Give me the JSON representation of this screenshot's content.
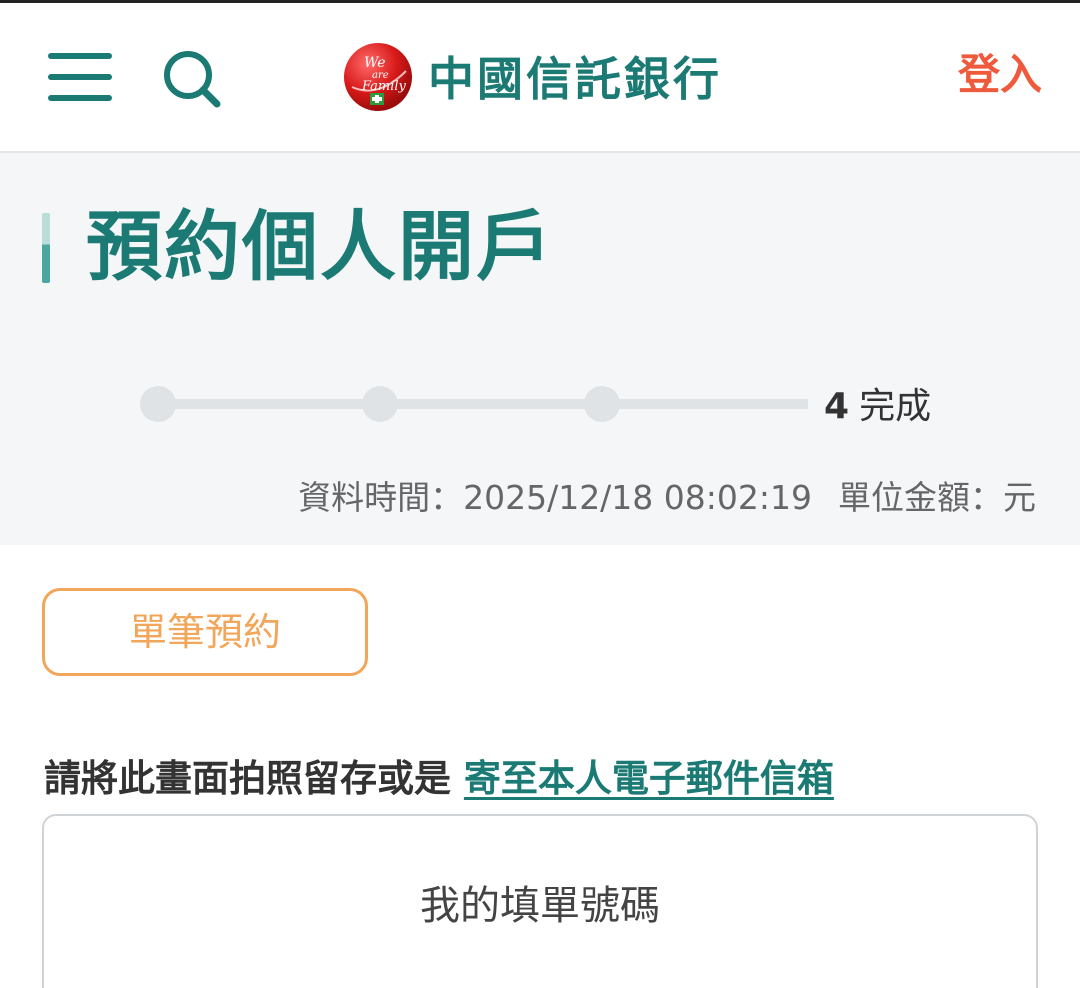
{
  "header": {
    "menu_icon": "hamburger-menu-icon",
    "search_icon": "search-icon",
    "logo_text": "We are Family",
    "bank_name": "中國信託銀行",
    "login_label": "登入"
  },
  "hero": {
    "title": "預約個人開戶",
    "stepper": {
      "current_step_number": "4",
      "current_step_label": "完成"
    },
    "data_time": "資料時間：2025/12/18 08:02:19",
    "unit": "單位金額：元"
  },
  "body": {
    "tab_single_label": "單筆預約",
    "instruction_text": "請將此畫面拍照留存或是",
    "email_link": "寄至本人電子郵件信箱",
    "card_label": "我的填單號碼"
  },
  "colors": {
    "brand_green": "#1b7a73",
    "login_red": "#ef5a3c",
    "tab_orange": "#f2a65a",
    "hero_bg": "#f4f6f8"
  }
}
